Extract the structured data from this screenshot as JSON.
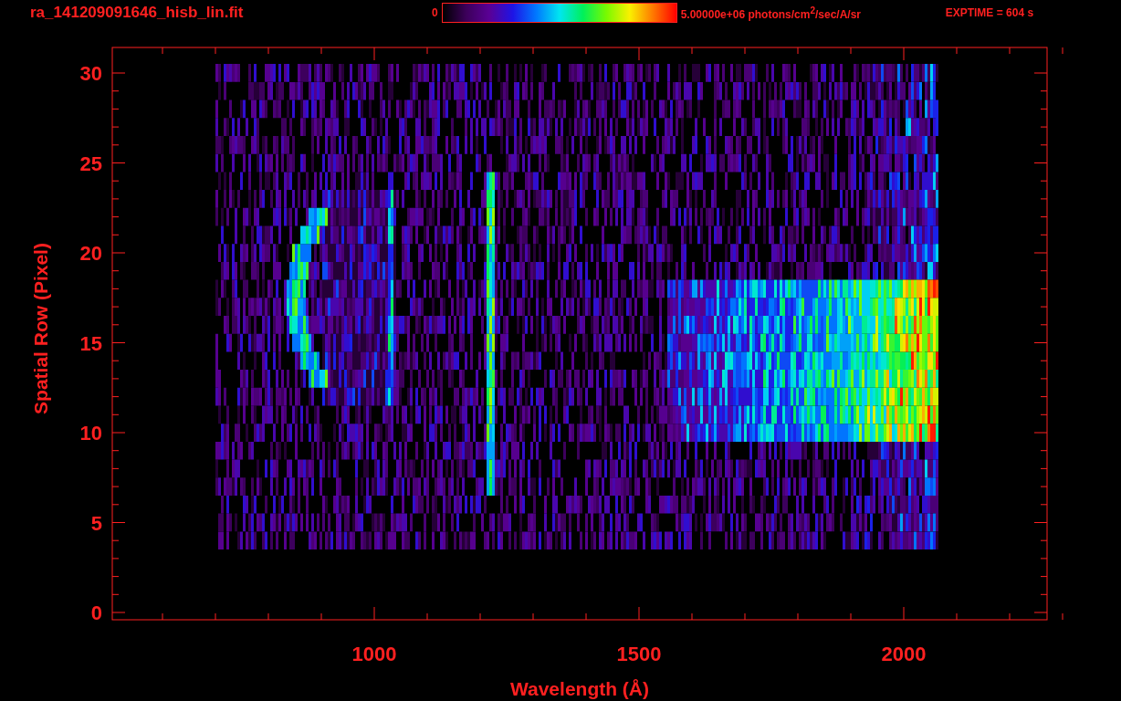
{
  "header": {
    "file_name": "ra_141209091646_hisb_lin.fit",
    "colorbar_min": "0",
    "colorbar_max": "5.00000e+06 photons/cm$^{2}$/sec/A/sr",
    "exposure": "EXPTIME = 604 s"
  },
  "plot": {
    "x_label": "Wavelength (Å)",
    "y_label": "Spatial Row (Pixel)",
    "x_tick_labels": [
      "1000",
      "1500",
      "2000"
    ],
    "y_tick_labels": [
      "30",
      "25",
      "20",
      "15",
      "10",
      "5",
      "0"
    ]
  }
}
